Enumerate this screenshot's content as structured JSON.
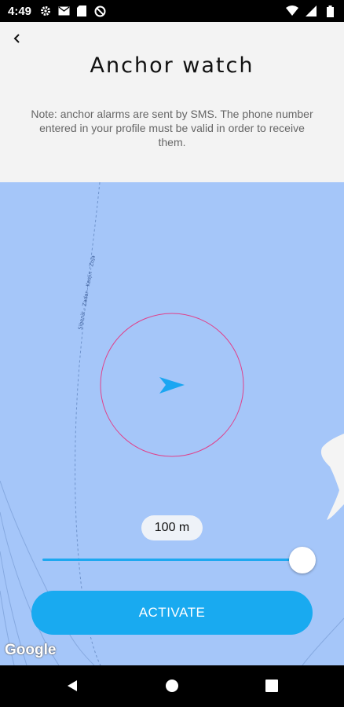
{
  "status_bar": {
    "time": "4:49",
    "left_icons": [
      "gear-icon",
      "mail-icon",
      "sd-card-icon",
      "no-disturb-icon"
    ],
    "right_icons": [
      "wifi-icon",
      "signal-icon",
      "battery-icon"
    ]
  },
  "header": {
    "back_icon": "chevron-left-icon",
    "title": "Anchor watch",
    "note": "Note: anchor alarms are sent by SMS.  The phone number entered in your profile must be valid in order to receive them."
  },
  "map": {
    "route_label": "Sibenik - Zadar - Kasjin - Zoja",
    "alarm_radius_color": "#e0408a",
    "boat_color": "#1aa6f2",
    "water_color": "#a5c6f9",
    "attribution": "Google"
  },
  "controls": {
    "distance_label": "100 m",
    "slider_value_fraction": 1.0,
    "activate_label": "ACTIVATE",
    "accent_color": "#19aaf0"
  },
  "nav_bar": {
    "icons": [
      "back-triangle-icon",
      "home-circle-icon",
      "recents-square-icon"
    ]
  }
}
